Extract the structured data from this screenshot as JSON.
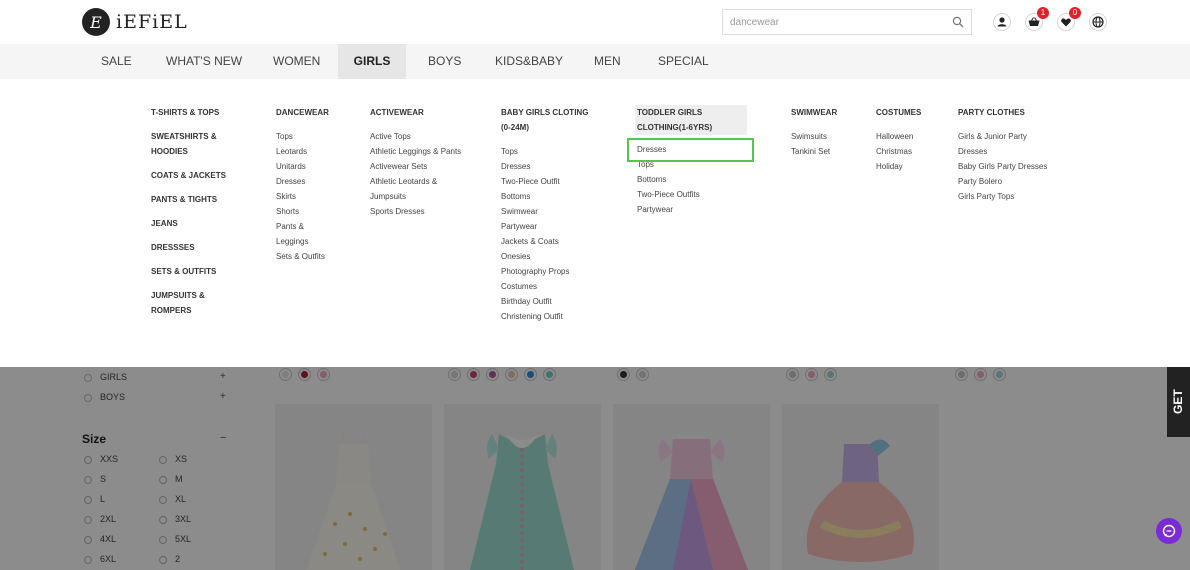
{
  "logo": {
    "mark": "E",
    "text": "iEFiEL"
  },
  "search": {
    "value": "dancewear",
    "icon": "search-icon"
  },
  "header_icons": {
    "account": "user-icon",
    "cart": "basket-icon",
    "cart_count": "1",
    "wishlist": "heart-icon",
    "wishlist_count": "0",
    "language": "globe-icon"
  },
  "nav": {
    "items": [
      "SALE",
      "WHAT'S NEW",
      "WOMEN",
      "GIRLS",
      "BOYS",
      "KIDS&BABY",
      "MEN",
      "SPECIAL"
    ],
    "active": "GIRLS"
  },
  "mega": {
    "categories": [
      "T-SHIRTS & TOPS",
      "SWEATSHIRTS & HOODIES",
      "COATS & JACKETS",
      "PANTS & TIGHTS",
      "JEANS",
      "DRESSSES",
      "SETS & OUTFITS",
      "JUMPSUITS & ROMPERS"
    ],
    "columns": [
      {
        "title": "DANCEWEAR",
        "links": [
          "Tops",
          "Leotards",
          "Unitards",
          "Dresses",
          "Skirts",
          "Shorts",
          "Pants & Leggings",
          "Sets & Outfits"
        ]
      },
      {
        "title": "ACTIVEWEAR",
        "links": [
          "Active Tops",
          "Athletic Leggings & Pants",
          "Activewear Sets",
          "Athletic Leotards & Jumpsuits",
          "Sports Dresses"
        ]
      },
      {
        "title": "BABY GIRLS CLOTING (0-24M)",
        "links": [
          "Tops",
          "Dresses",
          "Two-Piece Outfit",
          "Bottoms",
          "Swimwear",
          "Partywear",
          "Jackets & Coats",
          "Onesies",
          "Photography Props",
          "Costumes",
          "Birthday Outfit",
          "Christening Outfit"
        ]
      },
      {
        "title": "TODDLER GIRLS CLOTHING(1-6YRS)",
        "links": [
          "Dresses",
          "Tops",
          "Bottoms",
          "Two-Piece Outfits",
          "Partywear"
        ]
      },
      {
        "title": "SWIMWEAR",
        "links": [
          "Swimsuits",
          "Tankini Set"
        ]
      },
      {
        "title": "COSTUMES",
        "links": [
          "Halloween",
          "Christmas",
          "Holiday"
        ]
      },
      {
        "title": "PARTY CLOTHES",
        "links": [
          "Girls & Junior Party",
          "Dresses",
          "Baby Girls Party Dresses",
          "Party Bolero",
          "Girls Party Tops"
        ]
      }
    ]
  },
  "filters": {
    "gender": [
      "GIRLS",
      "BOYS"
    ],
    "size_title": "Size",
    "sizes_left": [
      "XXS",
      "S",
      "L",
      "2XL",
      "4XL",
      "6XL"
    ],
    "sizes_right": [
      "XS",
      "M",
      "XL",
      "3XL",
      "5XL",
      "2"
    ]
  },
  "side_tab": "GET",
  "colors": {
    "accent_badge": "#e0202a",
    "chat": "#7b2bd6",
    "focus": "#55c455"
  }
}
